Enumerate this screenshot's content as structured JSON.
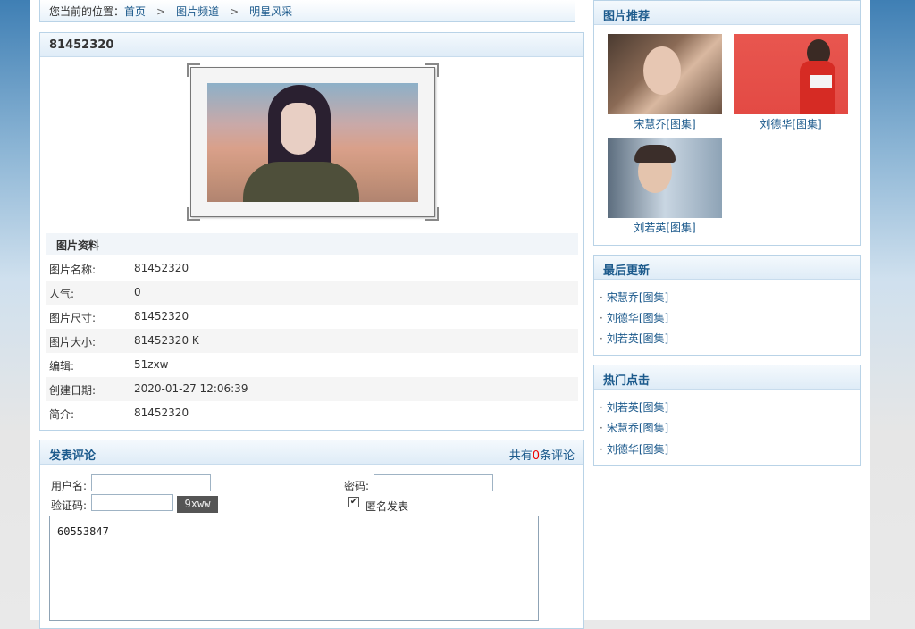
{
  "breadcrumb": {
    "prefix": "您当前的位置：",
    "home": "首页",
    "sep": ">",
    "channel": "图片频道",
    "category": "明星风采"
  },
  "photo": {
    "title": "81452320"
  },
  "info": {
    "heading": "图片资料",
    "rows": [
      {
        "label": "图片名称:",
        "value": "81452320"
      },
      {
        "label": "人气:",
        "value": "0"
      },
      {
        "label": "图片尺寸:",
        "value": "81452320"
      },
      {
        "label": "图片大小:",
        "value": "81452320 K"
      },
      {
        "label": "编辑:",
        "value": "51zxw"
      },
      {
        "label": "创建日期:",
        "value": "2020-01-27 12:06:39"
      },
      {
        "label": "简介:",
        "value": "81452320"
      }
    ]
  },
  "comment": {
    "title": "发表评论",
    "count_prefix": "共有",
    "count": "0",
    "count_suffix": "条评论",
    "username_label": "用户名:",
    "password_label": "密码:",
    "captcha_label": "验证码:",
    "captcha_code": "9xww",
    "anonymous_label": "匿名发表",
    "anonymous_checked": "✔",
    "textarea_value": "60553847"
  },
  "recommend": {
    "title": "图片推荐",
    "items": [
      {
        "caption": "宋慧乔[图集]"
      },
      {
        "caption": "刘德华[图集]"
      },
      {
        "caption": "刘若英[图集]"
      }
    ]
  },
  "latest": {
    "title": "最后更新",
    "items": [
      "宋慧乔[图集]",
      "刘德华[图集]",
      "刘若英[图集]"
    ]
  },
  "hot": {
    "title": "热门点击",
    "items": [
      "刘若英[图集]",
      "宋慧乔[图集]",
      "刘德华[图集]"
    ]
  }
}
